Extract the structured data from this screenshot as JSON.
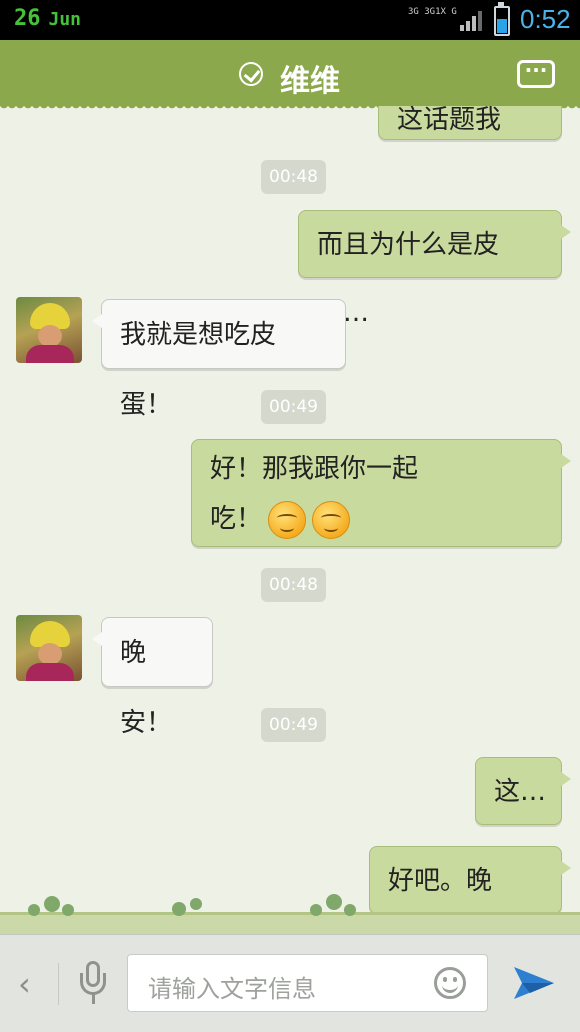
{
  "status_bar": {
    "date_day": "26",
    "date_month": "Jun",
    "network": "3G 3G1X G",
    "time": "0:52"
  },
  "header": {
    "title": "维维"
  },
  "messages": [
    {
      "type": "sent",
      "text": "这话题我将…"
    },
    {
      "type": "timestamp",
      "text": "00:48"
    },
    {
      "type": "sent",
      "text": "而且为什么是皮蛋…"
    },
    {
      "type": "received",
      "text": "我就是想吃皮蛋！"
    },
    {
      "type": "timestamp",
      "text": "00:49"
    },
    {
      "type": "sent",
      "line1": "好！那我跟你一起",
      "line2": "吃！"
    },
    {
      "type": "timestamp",
      "text": "00:48"
    },
    {
      "type": "received",
      "text": "晚安！"
    },
    {
      "type": "timestamp",
      "text": "00:49"
    },
    {
      "type": "sent",
      "text": "这…"
    },
    {
      "type": "sent",
      "text": "好吧。晚安！"
    }
  ],
  "input_bar": {
    "placeholder": "请输入文字信息"
  },
  "colors": {
    "header": "#8ca84c",
    "sent_bubble": "#c9da9e",
    "received_bubble": "#f8f8f6",
    "background": "#eef1e6",
    "send_icon": "#2f7fd0"
  }
}
